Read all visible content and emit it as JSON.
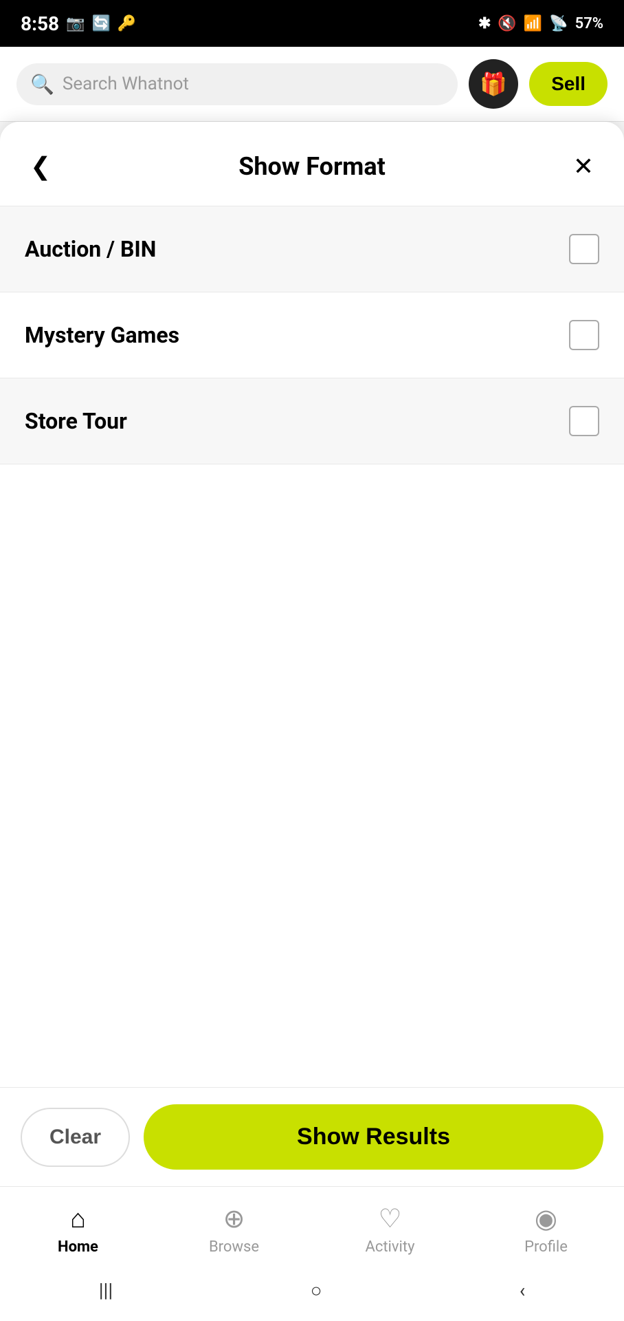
{
  "statusBar": {
    "time": "8:58",
    "icons": [
      "camera",
      "refresh",
      "key",
      "bluetooth",
      "mute",
      "wifi",
      "signal",
      "battery"
    ],
    "batteryPercent": "57%"
  },
  "searchBar": {
    "placeholder": "Search Whatnot",
    "giftIcon": "🎁",
    "sellLabel": "Sell"
  },
  "sheet": {
    "title": "Show Format",
    "backLabel": "‹",
    "closeLabel": "✕"
  },
  "options": [
    {
      "id": "auction-bin",
      "label": "Auction / BIN",
      "checked": false
    },
    {
      "id": "mystery-games",
      "label": "Mystery Games",
      "checked": false
    },
    {
      "id": "store-tour",
      "label": "Store Tour",
      "checked": false
    }
  ],
  "actions": {
    "clearLabel": "Clear",
    "showResultsLabel": "Show Results"
  },
  "bottomNav": {
    "items": [
      {
        "id": "home",
        "label": "Home",
        "active": true
      },
      {
        "id": "browse",
        "label": "Browse",
        "active": false
      },
      {
        "id": "activity",
        "label": "Activity",
        "active": false
      },
      {
        "id": "profile",
        "label": "Profile",
        "active": false
      }
    ]
  },
  "systemNav": {
    "buttons": [
      "|||",
      "○",
      "‹"
    ]
  }
}
